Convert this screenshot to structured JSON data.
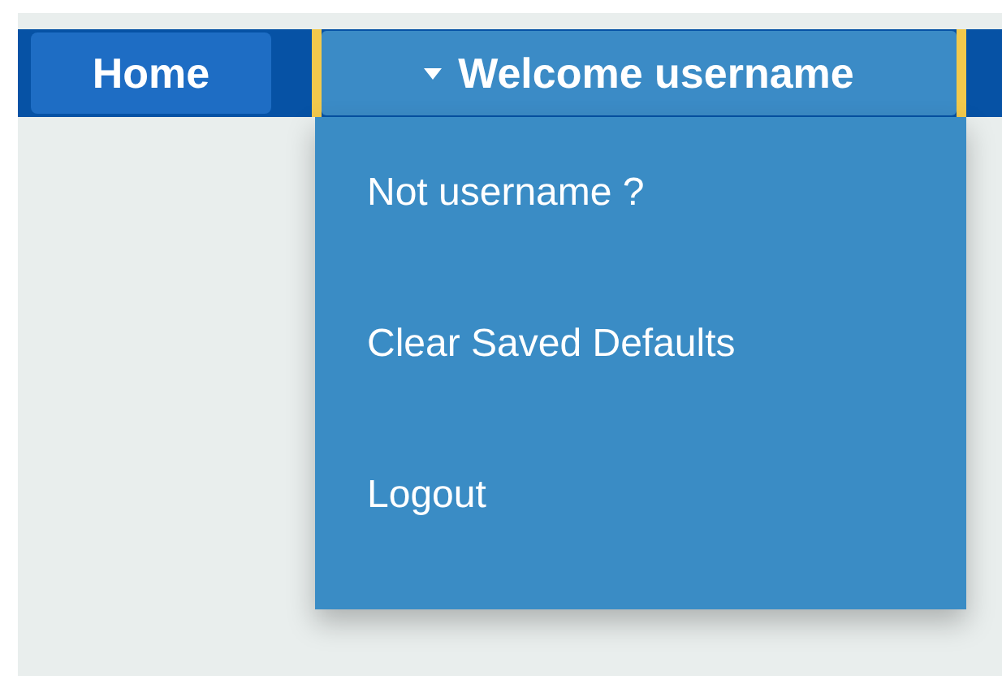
{
  "nav": {
    "home": {
      "label": "Home"
    },
    "user_menu": {
      "label": "Welcome username",
      "expanded": true,
      "items": [
        {
          "label": "Not username ?"
        },
        {
          "label": "Clear Saved Defaults"
        },
        {
          "label": "Logout"
        }
      ]
    }
  }
}
